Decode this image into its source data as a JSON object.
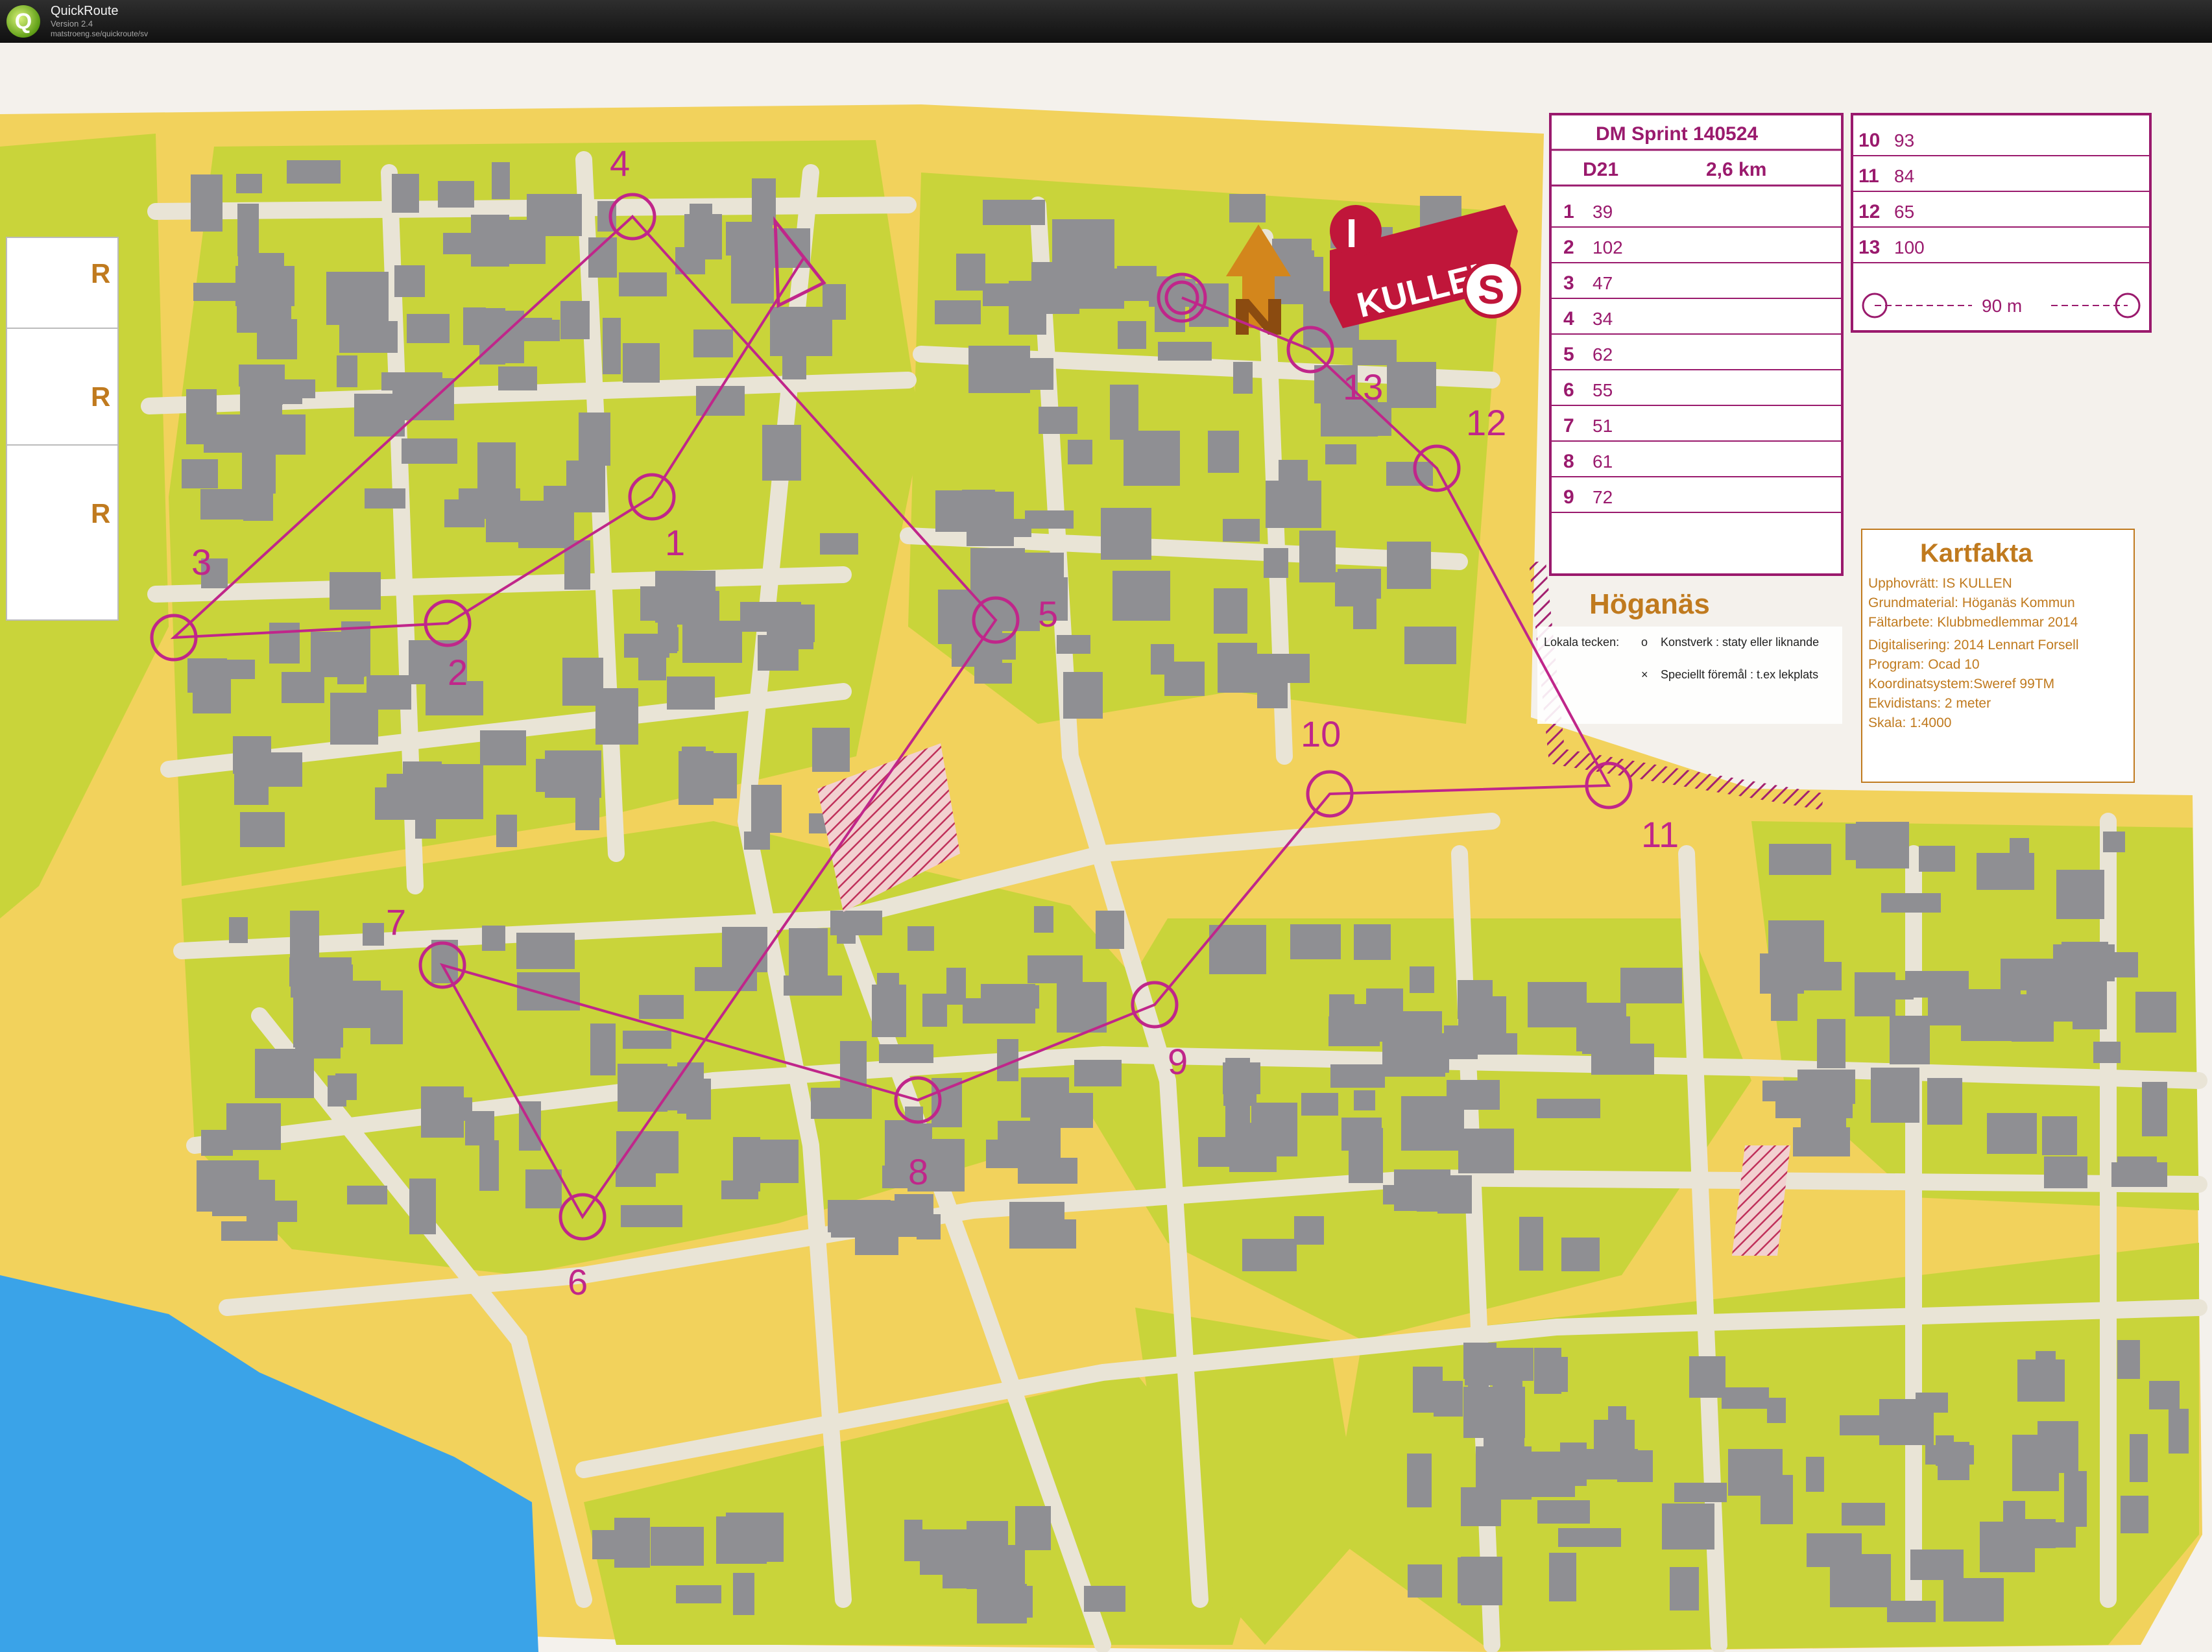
{
  "window": {
    "app_name": "QuickRoute",
    "version": "Version 2.4",
    "url": "matstroeng.se/quickroute/sv"
  },
  "map": {
    "town_label": "Höganäs",
    "side_markers": [
      "R",
      "R",
      "R"
    ],
    "colors": {
      "course": "#c0268a",
      "open_land": "#f2d25c",
      "rough_open": "#f6e7a0",
      "forest": "#c9d43a",
      "building": "#8f8f93",
      "road": "#e9e4d6",
      "water": "#3aa3e8"
    },
    "logo": {
      "letters": [
        "I",
        "KULLEN",
        "S"
      ],
      "north_arrow": "north-arrow-icon"
    }
  },
  "course": {
    "controls": [
      {
        "code": "1",
        "label": "1"
      },
      {
        "code": "2",
        "label": "2"
      },
      {
        "code": "3",
        "label": "3"
      },
      {
        "code": "4",
        "label": "4"
      },
      {
        "code": "5",
        "label": "5"
      },
      {
        "code": "6",
        "label": "6"
      },
      {
        "code": "7",
        "label": "7"
      },
      {
        "code": "8",
        "label": "8"
      },
      {
        "code": "9",
        "label": "9"
      },
      {
        "code": "10",
        "label": "10"
      },
      {
        "code": "11",
        "label": "11"
      },
      {
        "code": "12",
        "label": "12"
      },
      {
        "code": "13",
        "label": "13"
      }
    ]
  },
  "description_sheet": {
    "event": "DM Sprint 140524",
    "class": "D21",
    "length": "2,6 km",
    "rows_left": [
      {
        "n": "1",
        "code": "39"
      },
      {
        "n": "2",
        "code": "102"
      },
      {
        "n": "3",
        "code": "47"
      },
      {
        "n": "4",
        "code": "34"
      },
      {
        "n": "5",
        "code": "62"
      },
      {
        "n": "6",
        "code": "55"
      },
      {
        "n": "7",
        "code": "51"
      },
      {
        "n": "8",
        "code": "61"
      },
      {
        "n": "9",
        "code": "72"
      }
    ],
    "rows_right": [
      {
        "n": "10",
        "code": "93"
      },
      {
        "n": "11",
        "code": "84"
      },
      {
        "n": "12",
        "code": "65"
      },
      {
        "n": "13",
        "code": "100"
      }
    ],
    "finish_distance": "90 m"
  },
  "legend": {
    "title": "Lokala tecken:",
    "items": [
      {
        "symbol": "o",
        "text": "Konstverk : staty eller liknande"
      },
      {
        "symbol": "×",
        "text": "Speciellt föremål : t.ex lekplats"
      }
    ]
  },
  "kartfakta": {
    "title": "Kartfakta",
    "lines": [
      "Upphovrätt: IS KULLEN",
      "Grundmaterial: Höganäs Kommun",
      "Fältarbete: Klubbmedlemmar  2014",
      "Digitalisering:  2014 Lennart Forsell",
      "Program: Ocad 10",
      "Koordinatsystem:Sweref  99TM",
      "Ekvidistans: 2 meter",
      "Skala: 1:4000"
    ]
  }
}
